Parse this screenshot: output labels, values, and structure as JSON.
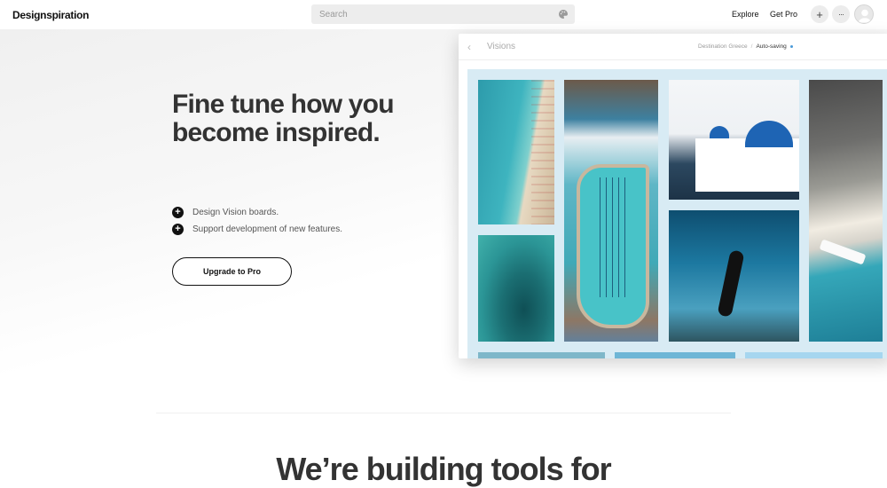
{
  "header": {
    "logo": "Designspiration",
    "search_placeholder": "Search",
    "explore_label": "Explore",
    "get_pro_label": "Get Pro",
    "plus_glyph": "+",
    "more_glyph": "···"
  },
  "hero": {
    "headline": "Fine tune how you become inspired.",
    "features": [
      {
        "glyph": "+",
        "text": "Design Vision boards."
      },
      {
        "glyph": "+",
        "text": "Support development of new features."
      }
    ],
    "cta_label": "Upgrade to Pro"
  },
  "board": {
    "back_glyph": "‹",
    "title": "Visions",
    "breadcrumb_board": "Destination Greece",
    "breadcrumb_sep": "/",
    "status": "Auto-saving"
  },
  "section": {
    "title": "We’re building tools for"
  },
  "colors": {
    "accent": "#111111",
    "status_dot": "#4a9ad8"
  },
  "icons": [
    "palette-icon",
    "plus-icon",
    "more-icon",
    "avatar-icon",
    "back-chevron-icon"
  ]
}
